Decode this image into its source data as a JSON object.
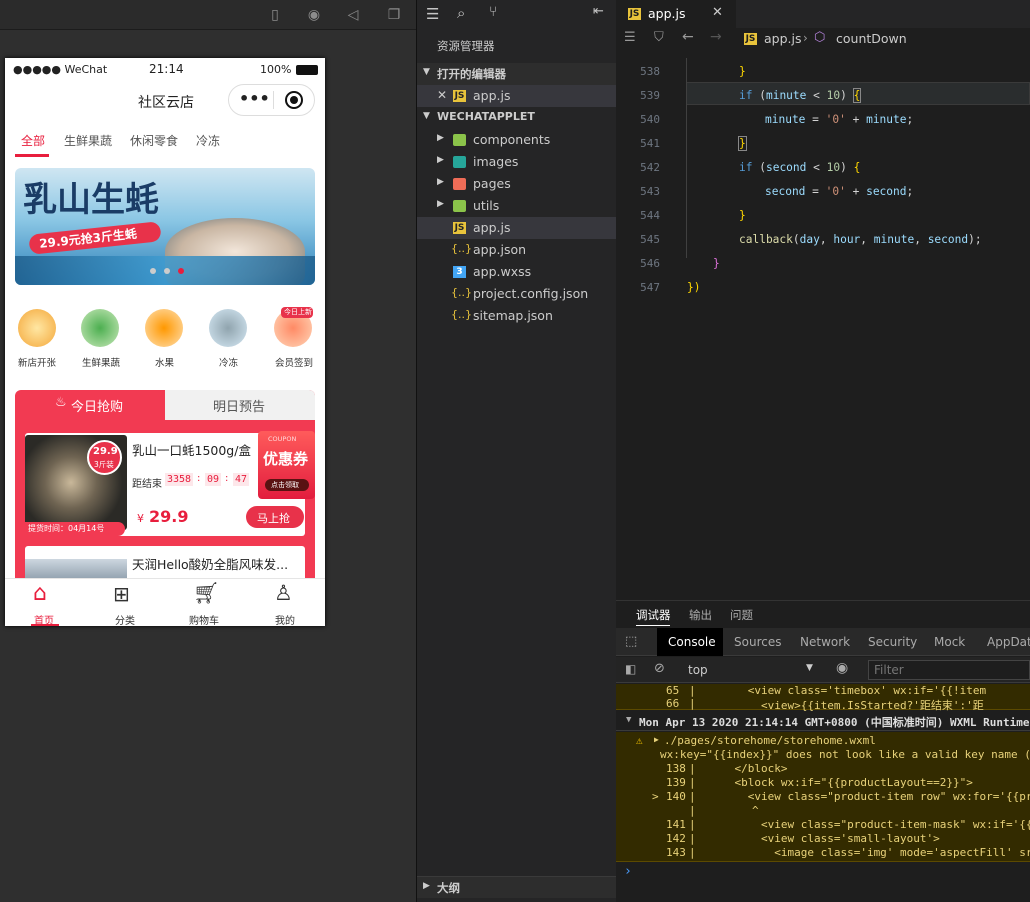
{
  "phone": {
    "status": {
      "carrier": "●●●●● WeChat",
      "time": "21:14",
      "battery": "100%"
    },
    "title": "社区云店",
    "capsule_dots": "•••",
    "tabs": [
      "全部",
      "生鲜果蔬",
      "休闲零食",
      "冷冻"
    ],
    "banner": {
      "title": "乳山生蚝",
      "subtitle": "29.9元抢3斤生蚝"
    },
    "categories": [
      "新店开张",
      "生鲜果蔬",
      "水果",
      "冷冻",
      "会员签到"
    ],
    "category_badge": "今日上新",
    "flash": {
      "tab_today": "今日抢购",
      "tab_tomorrow": "明日预告",
      "item1": {
        "name": "乳山一口蚝1500g/盒",
        "badge_price": "29.9",
        "badge_unit": "3斤装",
        "countdown_label": "距结束",
        "h": "3358",
        "m": "09",
        "s": "47",
        "currency": "¥",
        "price": "29.9",
        "buy": "马上抢",
        "delivery": "提货时间：04月14号",
        "coupon_top": "COUPON",
        "coupon_main": "优惠券",
        "coupon_btn": "点击领取"
      },
      "item2": {
        "name": "天润Hello酸奶全脂风味发..."
      }
    },
    "nav": [
      "首页",
      "分类",
      "购物车",
      "我的"
    ]
  },
  "explorer": {
    "title": "资源管理器",
    "open_editors": "打开的编辑器",
    "open_file": "app.js",
    "project": "WECHATAPPLET",
    "folders": [
      "components",
      "images",
      "pages",
      "utils"
    ],
    "files": [
      "app.js",
      "app.json",
      "app.wxss",
      "project.config.json",
      "sitemap.json"
    ],
    "outline": "大纲"
  },
  "editor": {
    "tab": "app.js",
    "breadcrumb_file": "app.js",
    "breadcrumb_symbol": "countDown",
    "line_numbers": [
      "538",
      "539",
      "540",
      "541",
      "542",
      "543",
      "544",
      "545",
      "546",
      "547"
    ]
  },
  "debug": {
    "tabs": [
      "调试器",
      "输出",
      "问题"
    ],
    "devtabs": [
      "Console",
      "Sources",
      "Network",
      "Security",
      "Mock",
      "AppData"
    ],
    "context": "top",
    "filter_placeholder": "Filter",
    "timestamp": "Mon Apr 13 2020 21:14:14 GMT+0800 (中国标准时间) WXML Runtime",
    "warn_path": "./pages/storehome/storehome.wxml",
    "warn_msg": "wx:key=\"{{index}}\" does not look like a valid key name (",
    "lines": [
      {
        "n": "65",
        "t": "      <view class='timebox' wx:if='{{!item"
      },
      {
        "n": "66",
        "t": "        <view>{{item.IsStarted?'距结束':'距"
      },
      {
        "n": "138",
        "t": "    </block>"
      },
      {
        "n": "139",
        "t": "    <block wx:if=\"{{productLayout==2}}\">"
      },
      {
        "n": "140",
        "t": "      <view class=\"product-item row\" wx:for='{{pr"
      },
      {
        "n": "141",
        "t": "        <view class=\"product-item-mask\" wx:if='{{"
      },
      {
        "n": "142",
        "t": "        <view class='small-layout'>"
      },
      {
        "n": "143",
        "t": "          <image class='img' mode='aspectFill' sr"
      }
    ]
  }
}
